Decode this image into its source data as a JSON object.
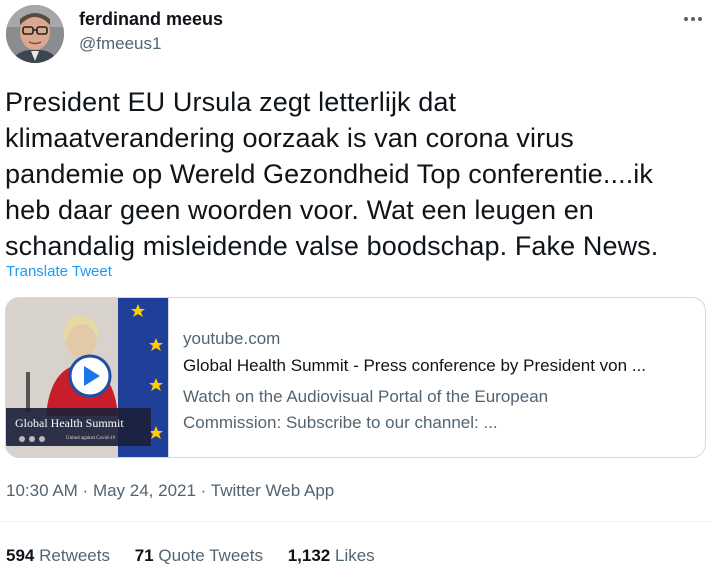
{
  "author": {
    "name": "ferdinand meeus",
    "handle": "@fmeeus1"
  },
  "tweet": {
    "text": "President EU Ursula zegt letterlijk dat\nklimaatverandering oorzaak is van corona virus\npandemie op Wereld Gezondheid Top conferentie....ik\nheb daar geen woorden voor. Wat een leugen en\nschandalig misleidende valse boodschap. Fake News.",
    "translate_label": "Translate Tweet"
  },
  "card": {
    "domain": "youtube.com",
    "title": "Global Health Summit - Press conference by President von ...",
    "description": "Watch on the Audiovisual Portal of the European\nCommission: Subscribe to our channel: ...",
    "thumbnail": {
      "banner_title": "Global Health Summit",
      "banner_subtitle": "United against Covid-19",
      "play_icon": "play-icon"
    }
  },
  "meta": {
    "time": "10:30 AM",
    "date": "May 24, 2021",
    "separator": " · ",
    "source": "Twitter Web App"
  },
  "stats": {
    "retweets_count": "594",
    "retweets_label": "Retweets",
    "quotes_count": "71",
    "quotes_label": "Quote Tweets",
    "likes_count": "1,132",
    "likes_label": "Likes"
  },
  "colors": {
    "link": "#1d9bf0",
    "secondary_text": "#536471",
    "border": "#cfd9de",
    "eu_blue": "#1f3f99"
  }
}
